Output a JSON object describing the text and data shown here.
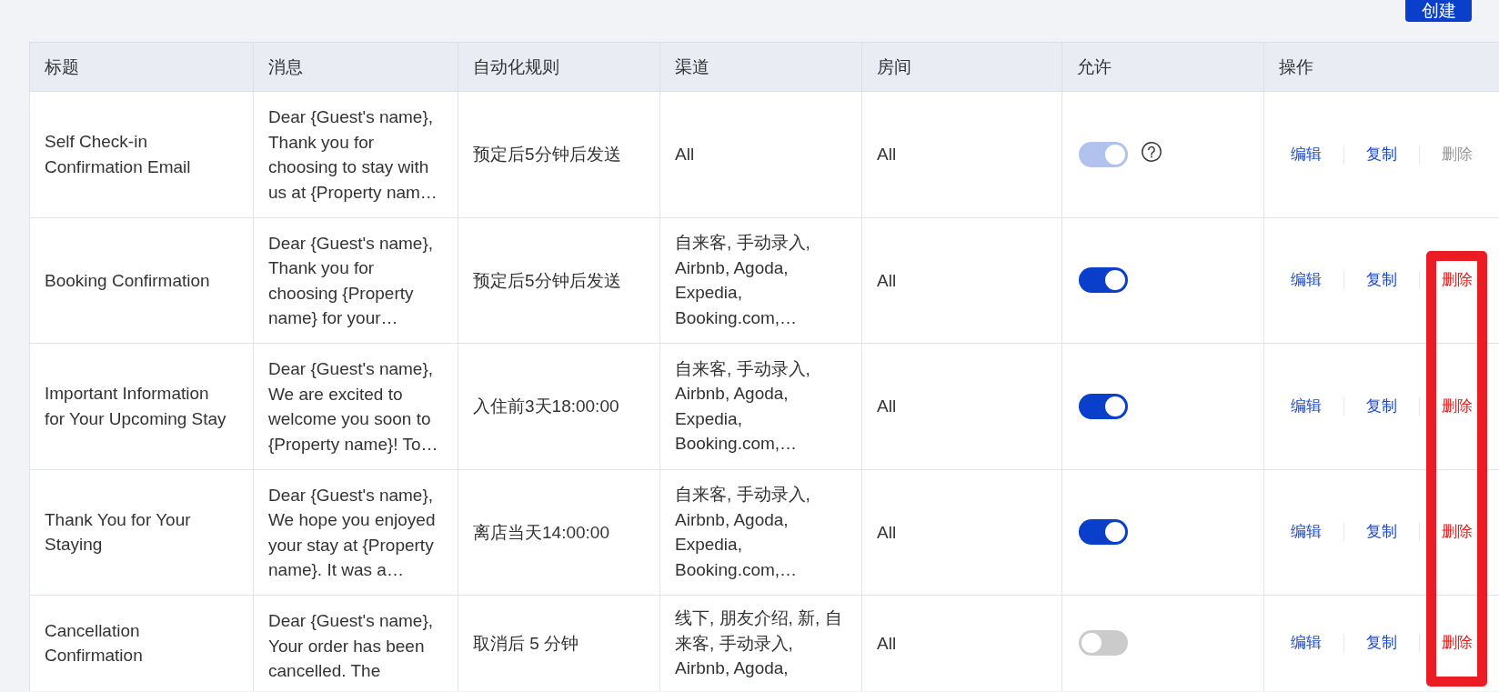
{
  "toolbar": {
    "create_button": "创建"
  },
  "table": {
    "columns": [
      "标题",
      "消息",
      "自动化规则",
      "渠道",
      "房间",
      "允许",
      "操作"
    ],
    "rows": [
      {
        "title": "Self Check-in Confirmation Email",
        "message": "Dear {Guest's name}, Thank you for choosing to stay with us at {Property nam…",
        "rule": "预定后5分钟后发送",
        "channels": "All",
        "rooms": "All",
        "allow": {
          "on": true,
          "disabled": true,
          "help": true
        },
        "actions": [
          {
            "kind": "edit",
            "label": "编辑",
            "disabled": false
          },
          {
            "kind": "copy",
            "label": "复制",
            "disabled": false
          },
          {
            "kind": "delete",
            "label": "删除",
            "disabled": true
          }
        ]
      },
      {
        "title": "Booking Confirmation",
        "message": "Dear {Guest's name}, Thank you for choosing {Property name} for your…",
        "rule": "预定后5分钟后发送",
        "channels": "自来客, 手动录入, Airbnb, Agoda, Expedia, Booking.com,…",
        "rooms": "All",
        "allow": {
          "on": true,
          "disabled": false
        },
        "actions": [
          {
            "kind": "edit",
            "label": "编辑",
            "disabled": false
          },
          {
            "kind": "copy",
            "label": "复制",
            "disabled": false
          },
          {
            "kind": "delete",
            "label": "删除",
            "disabled": false
          }
        ]
      },
      {
        "title": "Important Information for Your Upcoming Stay",
        "message": "Dear {Guest's name}, We are excited to welcome you soon to {Property name}! To…",
        "rule": "入住前3天18:00:00",
        "channels": "自来客, 手动录入, Airbnb, Agoda, Expedia, Booking.com,…",
        "rooms": "All",
        "allow": {
          "on": true,
          "disabled": false
        },
        "actions": [
          {
            "kind": "edit",
            "label": "编辑",
            "disabled": false
          },
          {
            "kind": "copy",
            "label": "复制",
            "disabled": false
          },
          {
            "kind": "delete",
            "label": "删除",
            "disabled": false
          }
        ]
      },
      {
        "title": "Thank You for Your Staying",
        "message": "Dear {Guest's name}, We hope you enjoyed your stay at {Property name}. It was a…",
        "rule": "离店当天14:00:00",
        "channels": "自来客, 手动录入, Airbnb, Agoda, Expedia, Booking.com,…",
        "rooms": "All",
        "allow": {
          "on": true,
          "disabled": false
        },
        "actions": [
          {
            "kind": "edit",
            "label": "编辑",
            "disabled": false
          },
          {
            "kind": "copy",
            "label": "复制",
            "disabled": false
          },
          {
            "kind": "delete",
            "label": "删除",
            "disabled": false
          }
        ]
      },
      {
        "title": "Cancellation Confirmation",
        "message": "Dear {Guest's name}, Your order has been cancelled. The",
        "rule": "取消后 5 分钟",
        "channels": "线下, 朋友介绍, 新, 自来客, 手动录入, Airbnb, Agoda,",
        "rooms": "All",
        "allow": {
          "on": false,
          "disabled": false
        },
        "actions": [
          {
            "kind": "edit",
            "label": "编辑",
            "disabled": false
          },
          {
            "kind": "copy",
            "label": "复制",
            "disabled": false
          },
          {
            "kind": "delete",
            "label": "删除",
            "disabled": false
          }
        ]
      }
    ]
  }
}
